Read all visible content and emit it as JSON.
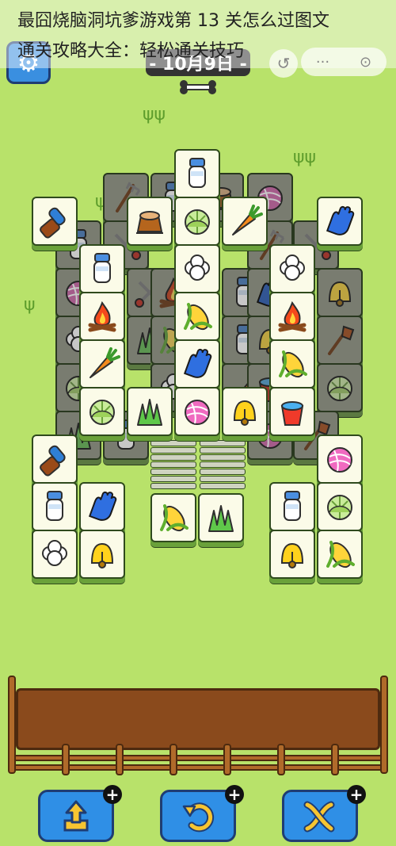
{
  "title": {
    "line1": "最囧烧脑洞坑爹游戏第 13 关怎么过图文",
    "line2": "通关攻略大全：轻松通关技巧"
  },
  "header": {
    "date": "- 10月9日 -",
    "menu_label": "···",
    "close_label": "⊙",
    "back_label": "↺"
  },
  "icons": {
    "brush": "brush-icon",
    "milk": "milk-bottle-icon",
    "glove": "blue-glove-icon",
    "stump": "tree-stump-icon",
    "cabbage": "cabbage-icon",
    "carrot": "carrot-icon",
    "wool": "yarn-ball-icon",
    "fire": "campfire-icon",
    "cotton": "cotton-icon",
    "corn": "corn-icon",
    "grass": "grass-icon",
    "bell": "bell-icon",
    "bucket": "bucket-icon",
    "rake": "pitchfork-icon",
    "scissors": "shears-icon",
    "shovel": "shovel-icon"
  },
  "colors": {
    "background": "#b8e26a",
    "tile_face": "#fbfbe8",
    "tile_outline": "#2f4a1d",
    "button_blue": "#2f8fe6"
  },
  "tools": [
    {
      "name": "move-out-button",
      "icon": "move-out-icon",
      "badge": "+"
    },
    {
      "name": "undo-button",
      "icon": "undo-icon",
      "badge": "+"
    },
    {
      "name": "shuffle-button",
      "icon": "shuffle-icon",
      "badge": "+"
    }
  ]
}
